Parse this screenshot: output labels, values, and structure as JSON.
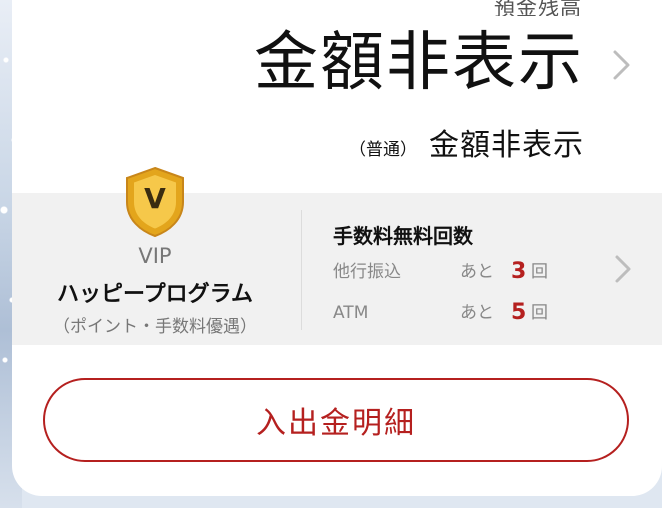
{
  "balance": {
    "label": "預金残高",
    "amount": "金額非表示",
    "account_type": "（普通）",
    "sub_amount": "金額非表示"
  },
  "vip": {
    "badge_letter": "V",
    "label": "VIP",
    "program_name": "ハッピープログラム",
    "program_sub": "（ポイント・手数料優遇）"
  },
  "fees": {
    "title": "手数料無料回数",
    "rows": [
      {
        "label": "他行振込",
        "prefix": "あと",
        "count": "3",
        "unit": "回"
      },
      {
        "label": "ATM",
        "prefix": "あと",
        "count": "5",
        "unit": "回"
      }
    ]
  },
  "actions": {
    "detail_label": "入出金明細"
  },
  "icons": {
    "balance_chevron": "chevron-right-icon",
    "fee_chevron": "chevron-right-icon",
    "badge": "vip-shield-icon"
  },
  "colors": {
    "accent": "#b5201f",
    "badge_gold": "#e3a51c"
  }
}
